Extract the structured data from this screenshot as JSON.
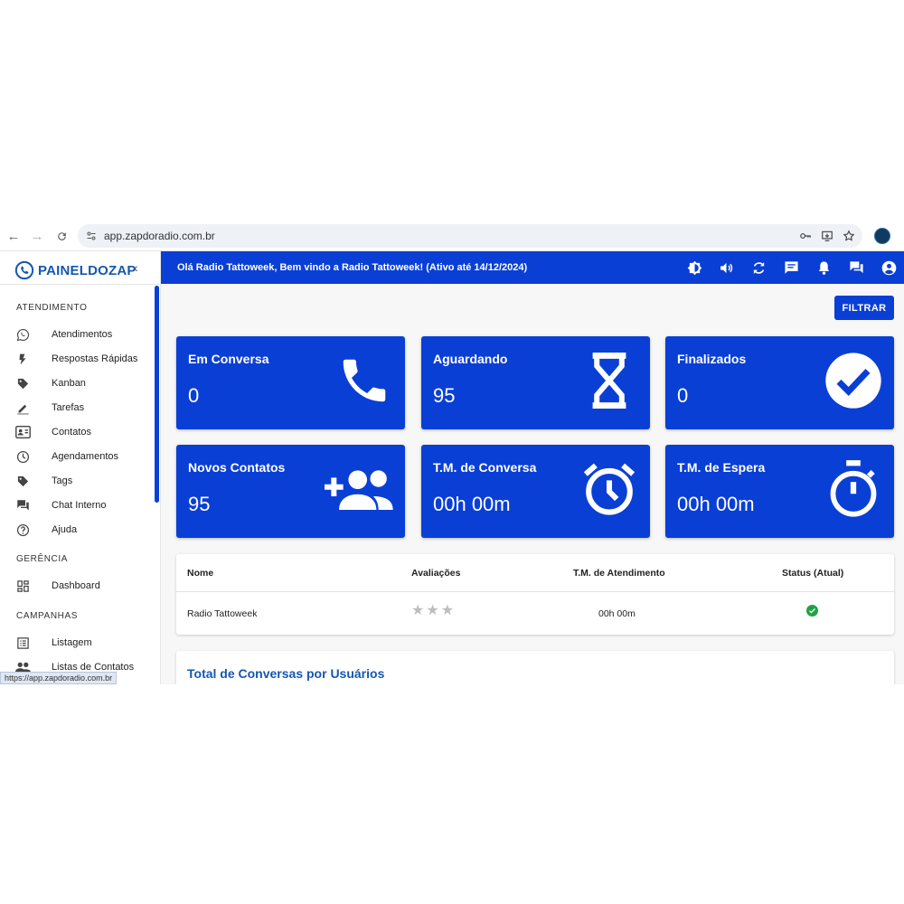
{
  "browser": {
    "url": "app.zapdoradio.com.br",
    "status_url": "https://app.zapdoradio.com.br"
  },
  "brand": {
    "logo_text": "PAINELDOZAP"
  },
  "appbar": {
    "welcome": "Olá Radio Tattoweek, Bem vindo a Radio Tattoweek! (Ativo até 14/12/2024)"
  },
  "sidebar": {
    "sections": [
      {
        "title": "ATENDIMENTO",
        "items": [
          {
            "label": "Atendimentos",
            "icon": "whatsapp-icon"
          },
          {
            "label": "Respostas Rápidas",
            "icon": "bolt-icon"
          },
          {
            "label": "Kanban",
            "icon": "tag-icon"
          },
          {
            "label": "Tarefas",
            "icon": "pencil-icon"
          },
          {
            "label": "Contatos",
            "icon": "contact-card-icon"
          },
          {
            "label": "Agendamentos",
            "icon": "clock-icon"
          },
          {
            "label": "Tags",
            "icon": "tag-icon"
          },
          {
            "label": "Chat Interno",
            "icon": "forum-icon"
          },
          {
            "label": "Ajuda",
            "icon": "help-icon"
          }
        ]
      },
      {
        "title": "GERÊNCIA",
        "items": [
          {
            "label": "Dashboard",
            "icon": "dashboard-icon"
          }
        ]
      },
      {
        "title": "CAMPANHAS",
        "items": [
          {
            "label": "Listagem",
            "icon": "list-icon"
          },
          {
            "label": "Listas de Contatos",
            "icon": "people-icon"
          }
        ]
      }
    ]
  },
  "main": {
    "filter_label": "FILTRAR",
    "cards": [
      {
        "title": "Em Conversa",
        "value": "0",
        "icon": "phone-icon"
      },
      {
        "title": "Aguardando",
        "value": "95",
        "icon": "hourglass-icon"
      },
      {
        "title": "Finalizados",
        "value": "0",
        "icon": "check-circle-icon"
      },
      {
        "title": "Novos Contatos",
        "value": "95",
        "icon": "group-add-icon"
      },
      {
        "title": "T.M. de Conversa",
        "value": "00h 00m",
        "icon": "alarm-icon"
      },
      {
        "title": "T.M. de Espera",
        "value": "00h 00m",
        "icon": "timer-icon"
      }
    ],
    "table": {
      "headers": [
        "Nome",
        "Avaliações",
        "T.M. de Atendimento",
        "Status (Atual)"
      ],
      "rows": [
        {
          "nome": "Radio Tattoweek",
          "rating": 0,
          "rating_max": 3,
          "tm": "00h 00m",
          "status": "online"
        }
      ]
    },
    "chart_title": "Total de Conversas por Usuários"
  },
  "colors": {
    "primary": "#0a3fd6",
    "accent_text": "#1557b0",
    "status_ok": "#1fa347",
    "star_empty": "#bdbdbd"
  }
}
